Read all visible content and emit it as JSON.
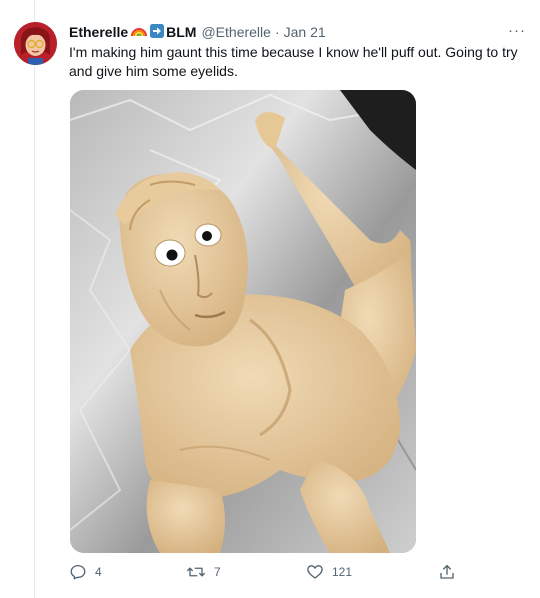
{
  "tweet": {
    "display_name": "Etherelle",
    "display_name_suffix": "BLM",
    "handle": "@Etherelle",
    "separator": "·",
    "date": "Jan 21",
    "more_label": "···",
    "text": "I'm making him gaunt this time because I know he'll puff out. Going to try and give him some eyelids."
  },
  "actions": {
    "reply_count": "4",
    "retweet_count": "7",
    "like_count": "121"
  },
  "icons": {
    "reply": "reply-icon",
    "retweet": "retweet-icon",
    "like": "heart-icon",
    "share": "share-icon",
    "more": "more-icon"
  },
  "colors": {
    "text_primary": "#0f1419",
    "text_secondary": "#536471",
    "divider": "#e6ecf0",
    "dough": "#e3c79c"
  }
}
